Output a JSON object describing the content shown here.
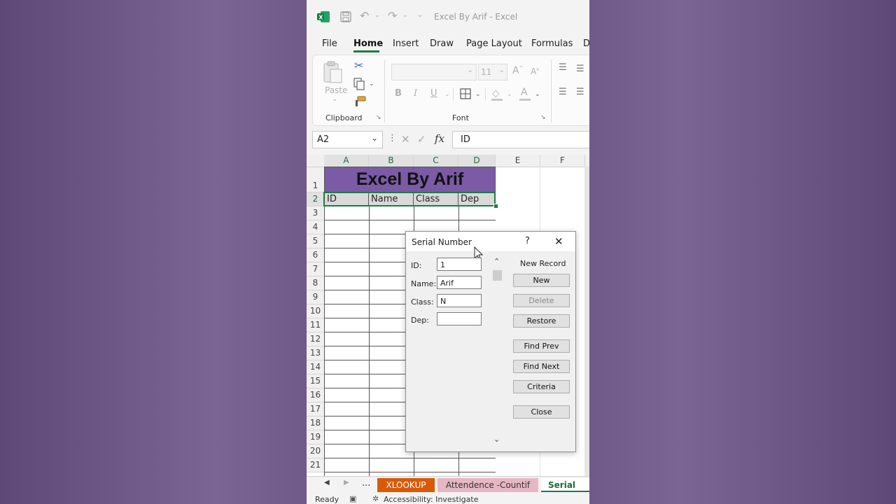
{
  "window": {
    "title": "Excel By Arif  -  Excel"
  },
  "ribbon": {
    "tabs": [
      "File",
      "Home",
      "Insert",
      "Draw",
      "Page Layout",
      "Formulas",
      "D"
    ],
    "active_tab": "Home",
    "clipboard": {
      "paste_label": "Paste",
      "group_label": "Clipboard"
    },
    "font": {
      "size": "11",
      "group_label": "Font"
    }
  },
  "formula_bar": {
    "name_box": "A2",
    "fx": "fx",
    "value": "ID"
  },
  "sheet": {
    "columns": [
      "A",
      "B",
      "C",
      "D",
      "E",
      "F"
    ],
    "rows": [
      "1",
      "2",
      "3",
      "4",
      "5",
      "6",
      "7",
      "8",
      "9",
      "10",
      "11",
      "12",
      "13",
      "14",
      "15",
      "16",
      "17",
      "18",
      "19",
      "20",
      "21"
    ],
    "title": "Excel By Arif",
    "headers": [
      "ID",
      "Name",
      "Class",
      "Dep"
    ],
    "title_color": "#7b5aa6"
  },
  "sheet_tabs": {
    "more": "...",
    "tabs": [
      {
        "label": "XLOOKUP",
        "color": "#d65b08"
      },
      {
        "label": "Attendence -Countif",
        "color": "#e6b8c4"
      },
      {
        "label": "Serial Nu",
        "color": "#ffffff"
      }
    ]
  },
  "status_bar": {
    "ready": "Ready",
    "accessibility": "Accessibility: Investigate"
  },
  "dialog": {
    "title": "Serial Number",
    "help": "?",
    "record_label": "New Record",
    "fields": [
      {
        "label": "ID:",
        "value": "1"
      },
      {
        "label": "Name:",
        "value": "Arif"
      },
      {
        "label": "Class:",
        "value": "N"
      },
      {
        "label": "Dep:",
        "value": ""
      }
    ],
    "buttons": [
      "New",
      "Delete",
      "Restore",
      "Find Prev",
      "Find Next",
      "Criteria",
      "Close"
    ]
  }
}
